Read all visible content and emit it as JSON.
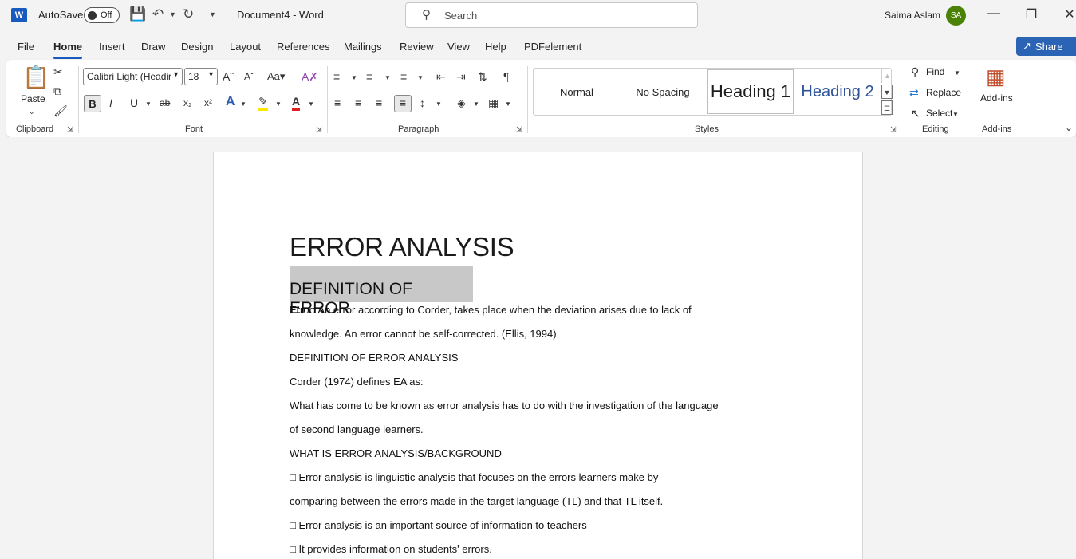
{
  "titlebar": {
    "app_letter": "W",
    "autosave_label": "AutoSave",
    "autosave_state": "Off",
    "document_title": "Document4  -  Word",
    "search_placeholder": "Search",
    "user_name": "Saima Aslam",
    "user_initials": "SA",
    "avatar_color": "#498205"
  },
  "menu": {
    "tabs": [
      "File",
      "Home",
      "Insert",
      "Draw",
      "Design",
      "Layout",
      "References",
      "Mailings",
      "Review",
      "View",
      "Help",
      "PDFelement"
    ],
    "active_tab": "Home",
    "share_label": "Share",
    "accent_color": "#185abd"
  },
  "ribbon": {
    "clipboard": {
      "paste_label": "Paste",
      "group_label": "Clipboard"
    },
    "font": {
      "font_name": "Calibri Light (Headir",
      "font_size": "18",
      "bold": "B",
      "italic": "I",
      "underline": "U",
      "strike": "ab",
      "subscript": "x₂",
      "superscript": "x²",
      "group_label": "Font"
    },
    "paragraph": {
      "group_label": "Paragraph"
    },
    "styles": {
      "items": [
        "Normal",
        "No Spacing",
        "Heading 1",
        "Heading 2"
      ],
      "selected": "Heading 1",
      "group_label": "Styles"
    },
    "editing": {
      "find_label": "Find",
      "replace_label": "Replace",
      "select_label": "Select",
      "group_label": "Editing"
    },
    "addins": {
      "button_label": "Add-ins",
      "group_label": "Add-ins"
    }
  },
  "document": {
    "title": "ERROR ANALYSIS",
    "heading": "DEFINITION OF ERROR",
    "paragraphs": [
      "Error: An error according to Corder, takes place when the deviation arises due to lack of",
      "knowledge. An error cannot be self-corrected. (Ellis, 1994)",
      "DEFINITION OF ERROR ANALYSIS",
      "Corder (1974) defines EA as:",
      "What has come to be known as error analysis has to do with the investigation of the language",
      "of second language learners.",
      "WHAT IS ERROR ANALYSIS/BACKGROUND",
      "□ Error analysis is linguistic analysis that focuses on the errors learners make by",
      "comparing between the errors made in the target language (TL) and that TL itself.",
      "□ Error analysis is an important source of information to teachers",
      "□ It provides information on students' errors."
    ]
  }
}
